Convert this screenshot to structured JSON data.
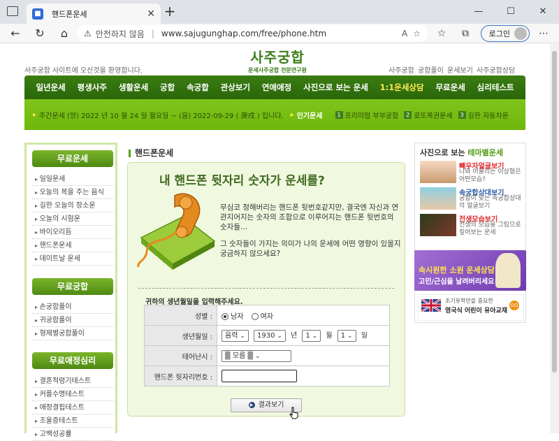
{
  "browser": {
    "tab_title": "핸드폰운세",
    "tab_close": "✕",
    "new_tab": "+",
    "insecure_label": "안전하지 않음",
    "url": "www.sajugunghap.com/free/phone.htm",
    "login_label": "로그인"
  },
  "site": {
    "welcome": "사주궁합 사이트에 오신것을 환영합니다.",
    "logo_main": "사주궁합",
    "logo_sub": "운세사주궁합 전문연구원",
    "top_links": [
      "사주궁합",
      "궁합풀이",
      "운세보기",
      "사주궁합상담"
    ],
    "nav": [
      "일년운세",
      "평생사주",
      "생활운세",
      "궁합",
      "속궁합",
      "관상보기",
      "연애애정",
      "사진으로 보는 운세",
      "1:1운세상담",
      "무료운세",
      "심리테스트"
    ],
    "date_line": "주간운세 (양) 2022 년 10 월 24 일 월요일 ~ (음) 2022-09-29 ( 庚戌 ) 입니다.",
    "popular_label": "인기운세",
    "popular": [
      "프리미엄 부부궁합",
      "로또복권운세",
      "길한 자동차운"
    ]
  },
  "sidebar": {
    "sections": [
      {
        "title": "무료운세",
        "items": [
          "일일운세",
          "오늘의 복을 주는 음식",
          "길한 오늘의 장소운",
          "오늘의 시험운",
          "바이오리듬",
          "핸드폰운세",
          "데이트날 운세"
        ]
      },
      {
        "title": "무료궁합",
        "items": [
          "손궁합풀이",
          "귀궁합풀이",
          "형제별궁합풀이"
        ]
      },
      {
        "title": "무료애정심리",
        "items": [
          "결혼적령기테스트",
          "커플수명테스트",
          "애정결핍테스트",
          "조울증테스트",
          "고백성공률"
        ]
      }
    ]
  },
  "content": {
    "page_title": "핸드폰운세",
    "headline": "내 핸드폰 뒷자리 숫자가 운세를?",
    "intro1": "무심코 정해버리는 핸드폰 뒷번호같지만, 결국엔 자신과 연관지어지는 숫자의 조합으로 이루어지는 핸드폰 뒷번호의 숫자들...",
    "intro2": "그 숫자들이 가지는 의미가 나의 운세에 어떤 영향이 있을지 궁금하지 않으세요?",
    "prompt": "귀하의 생년월일을 입력해주세요.",
    "form": {
      "gender_label": "성별",
      "male": "남자",
      "female": "여자",
      "birth_label": "생년월일",
      "calendar": "음력",
      "year": "1930",
      "year_unit": "년",
      "month": "1",
      "month_unit": "월",
      "day": "1",
      "day_unit": "일",
      "birthtime_label": "태어난시",
      "birthtime_value": "모름",
      "phone_label": "핸드폰 뒷자리번호",
      "phone_value": ""
    },
    "submit": "결과보기"
  },
  "right": {
    "title_a": "사진으로 보는 ",
    "title_b": "테마별운세",
    "items": [
      {
        "title": "빼우자얼굴보기",
        "desc": "나와 어울리는 이상형은 어떤모습?",
        "color": "#e0262b"
      },
      {
        "title": "속궁합상대보기",
        "desc": "궁합이 맞는 속궁합상대의 얼굴보기",
        "color": "#2d5aa8"
      },
      {
        "title": "전생모습보기",
        "desc": "전생의 모습을 그림으로 짚어보는 운세",
        "color": "#e0262b"
      }
    ],
    "banner1_title": "소원 운세상담",
    "banner1_prefix": "속시원한",
    "banner1_sub": "고민/근심을 날려버리세요~",
    "banner2_line1": "조기유학만을 중요한",
    "banner2_line2": "영국식 어린이 유아교재",
    "banner2_go": "GO"
  }
}
